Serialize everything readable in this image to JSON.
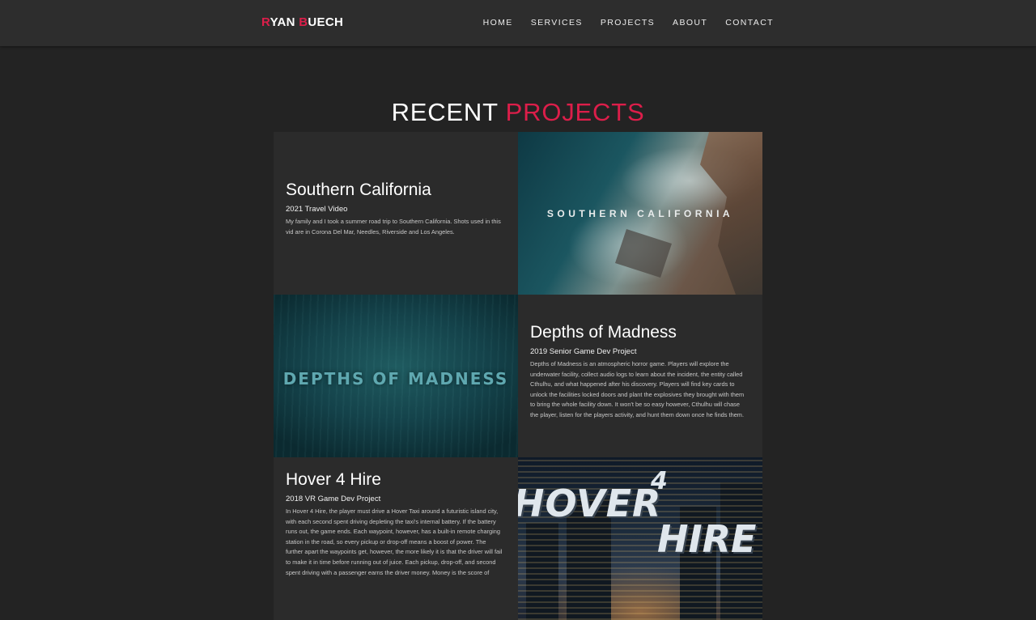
{
  "brand": {
    "first_initial": "R",
    "first_rest": "YAN ",
    "last_initial": "B",
    "last_rest": "UECH"
  },
  "nav": {
    "items": [
      "HOME",
      "SERVICES",
      "PROJECTS",
      "ABOUT",
      "CONTACT"
    ]
  },
  "section": {
    "title_main": "RECENT ",
    "title_accent": "PROJECTS"
  },
  "projects": [
    {
      "title": "Southern California",
      "subtitle": "2021 Travel Video",
      "description": "My family and I took a summer road trip to Southern California. Shots used in this vid are in Corona Del Mar, Needles, Riverside and Los Angeles.",
      "image_text": "SOUTHERN CALIFORNIA"
    },
    {
      "title": "Depths of Madness",
      "subtitle": "2019 Senior Game Dev Project",
      "description": "Depths of Madness is an atmospheric horror game. Players will explore the underwater facility, collect audio logs to learn about the incident, the entity called Cthulhu, and what happened after his discovery. Players will find key cards to unlock the facilities locked doors and plant the explosives they brought with them to bring the whole facility down. It won't be so easy however, Cthulhu will chase the player, listen for the players activity, and hunt them down once he finds them.",
      "image_text": "DEPTHS OF MADNESS"
    },
    {
      "title": "Hover 4 Hire",
      "subtitle": "2018 VR Game Dev Project",
      "description": "In Hover 4 Hire, the player must drive a Hover Taxi around a futuristic island city, with each second spent driving depleting the taxi's internal battery. If the battery runs out, the game ends. Each waypoint, however, has a built-in remote charging station in the road, so every pickup or drop-off means a boost of power. The further apart the waypoints get, however, the more likely it is that the driver will fail to make it in time before running out of juice. Each pickup, drop-off, and second spent driving with a passenger earns the driver money. Money is the score of",
      "image_text_a": "HOVER",
      "image_text_b": "4",
      "image_text_c": "HIRE"
    }
  ],
  "colors": {
    "accent": "#dc1e4a",
    "background": "#232323",
    "nav": "#2d2d2d",
    "card": "#2b2b2b"
  }
}
